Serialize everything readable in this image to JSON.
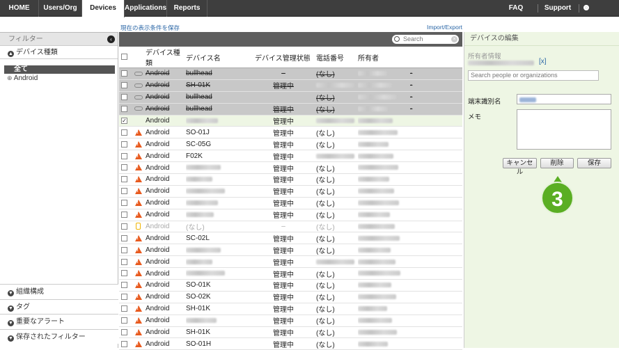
{
  "topnav": {
    "tabs": [
      {
        "label": "HOME"
      },
      {
        "label": "Users/Org"
      },
      {
        "label": "Devices"
      },
      {
        "label": "Applications"
      },
      {
        "label": "Reports"
      }
    ],
    "faq": "FAQ",
    "support": "Support",
    "settings": "Settings"
  },
  "sidebar": {
    "header": "フィルター",
    "section_device_type": "デバイス種類",
    "all": "全て",
    "android": "Android",
    "bottom_sections": [
      "組織構成",
      "タグ",
      "重要なアラート",
      "保存されたフィルター"
    ]
  },
  "main": {
    "save_filter_link": "現在の表示条件を保存",
    "import_export_link": "Import/Export",
    "search_placeholder": "Search",
    "columns": [
      "デバイス種類",
      "デバイス名",
      "デバイス管理状態",
      "電話番号",
      "所有者"
    ],
    "rows": [
      {
        "state": "unmanaged",
        "type": "Android",
        "name": "bullhead",
        "status": "–",
        "phone": "(なし)",
        "tail": "-"
      },
      {
        "state": "unmanaged",
        "type": "Android",
        "name": "SH-01K",
        "status": "管理中",
        "phone": "",
        "tail": "-"
      },
      {
        "state": "unmanaged",
        "type": "Android",
        "name": "bullhead",
        "status": "",
        "phone": "(なし)",
        "tail": "-"
      },
      {
        "state": "unmanaged",
        "type": "Android",
        "name": "bullhead",
        "status": "管理中",
        "phone": "(なし)",
        "tail": "-"
      },
      {
        "state": "selected",
        "type": "Android",
        "name": "",
        "status": "管理中",
        "phone": "",
        "tail": ""
      },
      {
        "state": "warn",
        "type": "Android",
        "name": "SO-01J",
        "status": "管理中",
        "phone": "(なし)",
        "tail": ""
      },
      {
        "state": "warn",
        "type": "Android",
        "name": "SC-05G",
        "status": "管理中",
        "phone": "(なし)",
        "tail": ""
      },
      {
        "state": "warn",
        "type": "Android",
        "name": "F02K",
        "status": "管理中",
        "phone": "",
        "tail": ""
      },
      {
        "state": "warn",
        "type": "Android",
        "name": "",
        "status": "管理中",
        "phone": "(なし)",
        "tail": ""
      },
      {
        "state": "warn",
        "type": "Android",
        "name": "",
        "status": "管理中",
        "phone": "(なし)",
        "tail": ""
      },
      {
        "state": "warn",
        "type": "Android",
        "name": "",
        "status": "管理中",
        "phone": "(なし)",
        "tail": ""
      },
      {
        "state": "warn",
        "type": "Android",
        "name": "",
        "status": "管理中",
        "phone": "(なし)",
        "tail": ""
      },
      {
        "state": "warn",
        "type": "Android",
        "name": "",
        "status": "管理中",
        "phone": "(なし)",
        "tail": ""
      },
      {
        "state": "inactive",
        "type": "Android",
        "name": "(なし)",
        "status": "–",
        "phone": "(なし)",
        "tail": ""
      },
      {
        "state": "warn",
        "type": "Android",
        "name": "SC-02L",
        "status": "管理中",
        "phone": "(なし)",
        "tail": ""
      },
      {
        "state": "warn",
        "type": "Android",
        "name": "",
        "status": "管理中",
        "phone": "(なし)",
        "tail": ""
      },
      {
        "state": "warn",
        "type": "Android",
        "name": "",
        "status": "管理中",
        "phone": "",
        "tail": ""
      },
      {
        "state": "warn",
        "type": "Android",
        "name": "",
        "status": "管理中",
        "phone": "(なし)",
        "tail": ""
      },
      {
        "state": "warn",
        "type": "Android",
        "name": "SO-01K",
        "status": "管理中",
        "phone": "(なし)",
        "tail": ""
      },
      {
        "state": "warn",
        "type": "Android",
        "name": "SO-02K",
        "status": "管理中",
        "phone": "(なし)",
        "tail": ""
      },
      {
        "state": "warn",
        "type": "Android",
        "name": "SH-01K",
        "status": "管理中",
        "phone": "(なし)",
        "tail": ""
      },
      {
        "state": "warn",
        "type": "Android",
        "name": "",
        "status": "管理中",
        "phone": "(なし)",
        "tail": ""
      },
      {
        "state": "warn",
        "type": "Android",
        "name": "SH-01K",
        "status": "管理中",
        "phone": "(なし)",
        "tail": ""
      },
      {
        "state": "warn",
        "type": "Android",
        "name": "SO-01H",
        "status": "管理中",
        "phone": "(なし)",
        "tail": ""
      }
    ]
  },
  "editor": {
    "title": "デバイスの編集",
    "owner_label": "所有者情報",
    "owner_remove": "[x]",
    "owner_search_placeholder": "Search people or organizations",
    "terminal_id_label": "端末識別名",
    "memo_label": "メモ",
    "cancel": "キャンセル",
    "delete": "削除",
    "save": "保存",
    "callout_number": "3"
  },
  "colors": {
    "topbar": "#3e3e3e",
    "accent_link": "#2a66a6",
    "warning": "#e85a1e",
    "callout": "#5aae23",
    "panel_bg": "#eef6e4"
  }
}
